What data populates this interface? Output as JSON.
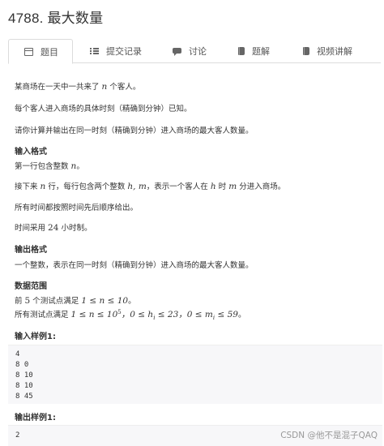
{
  "problem": {
    "title": "4788. 最大数量"
  },
  "tabs": [
    {
      "label": "题目",
      "icon": "document-icon",
      "active": true
    },
    {
      "label": "提交记录",
      "icon": "list-icon"
    },
    {
      "label": "讨论",
      "icon": "comment-icon"
    },
    {
      "label": "题解",
      "icon": "book-icon"
    },
    {
      "label": "视频讲解",
      "icon": "video-book-icon"
    }
  ],
  "statement": {
    "line1_pre": "某商场在一天中一共来了",
    "line1_var": "n",
    "line1_post": "个客人。",
    "line2": "每个客人进入商场的具体时刻（精确到分钟）已知。",
    "line3": "请你计算并输出在同一时刻（精确到分钟）进入商场的最大客人数量。"
  },
  "input_format": {
    "heading": "输入格式",
    "line1_pre": "第一行包含整数",
    "line1_var": "n",
    "line1_post": "。",
    "line2_a": "接下来",
    "line2_var_n": "n",
    "line2_b": "行，每行包含两个整数",
    "line2_var_hm": "h, m",
    "line2_c": "，表示一个客人在",
    "line2_var_h": "h",
    "line2_d": "时",
    "line2_var_m": "m",
    "line2_e": "分进入商场。",
    "line3": "所有时间都按照时间先后顺序给出。",
    "line4_pre": "时间采用",
    "line4_num": "24",
    "line4_post": "小时制。"
  },
  "output_format": {
    "heading": "输出格式",
    "line1": "一个整数，表示在同一时刻（精确到分钟）进入商场的最大客人数量。"
  },
  "data_range": {
    "heading": "数据范围",
    "line1_pre": "前",
    "line1_num": "5",
    "line1_mid": "个测试点满足",
    "line1_math": "1 ≤ n ≤ 10",
    "line1_post": "。",
    "line2_pre": "所有测试点满足",
    "line2_math_a": "1 ≤ n ≤ 10",
    "line2_exp": "5",
    "line2_math_b": "，0 ≤ h",
    "line2_sub_i1": "i",
    "line2_math_c": " ≤ 23，0 ≤ m",
    "line2_sub_i2": "i",
    "line2_math_d": " ≤ 59",
    "line2_post": "。"
  },
  "sample_input": {
    "heading": "输入样例1:",
    "lines": [
      "4",
      "8 0",
      "8 10",
      "8 10",
      "8 45"
    ]
  },
  "sample_output": {
    "heading": "输出样例1:",
    "lines": [
      "2"
    ]
  },
  "watermark": "CSDN @他不是混子QAQ"
}
